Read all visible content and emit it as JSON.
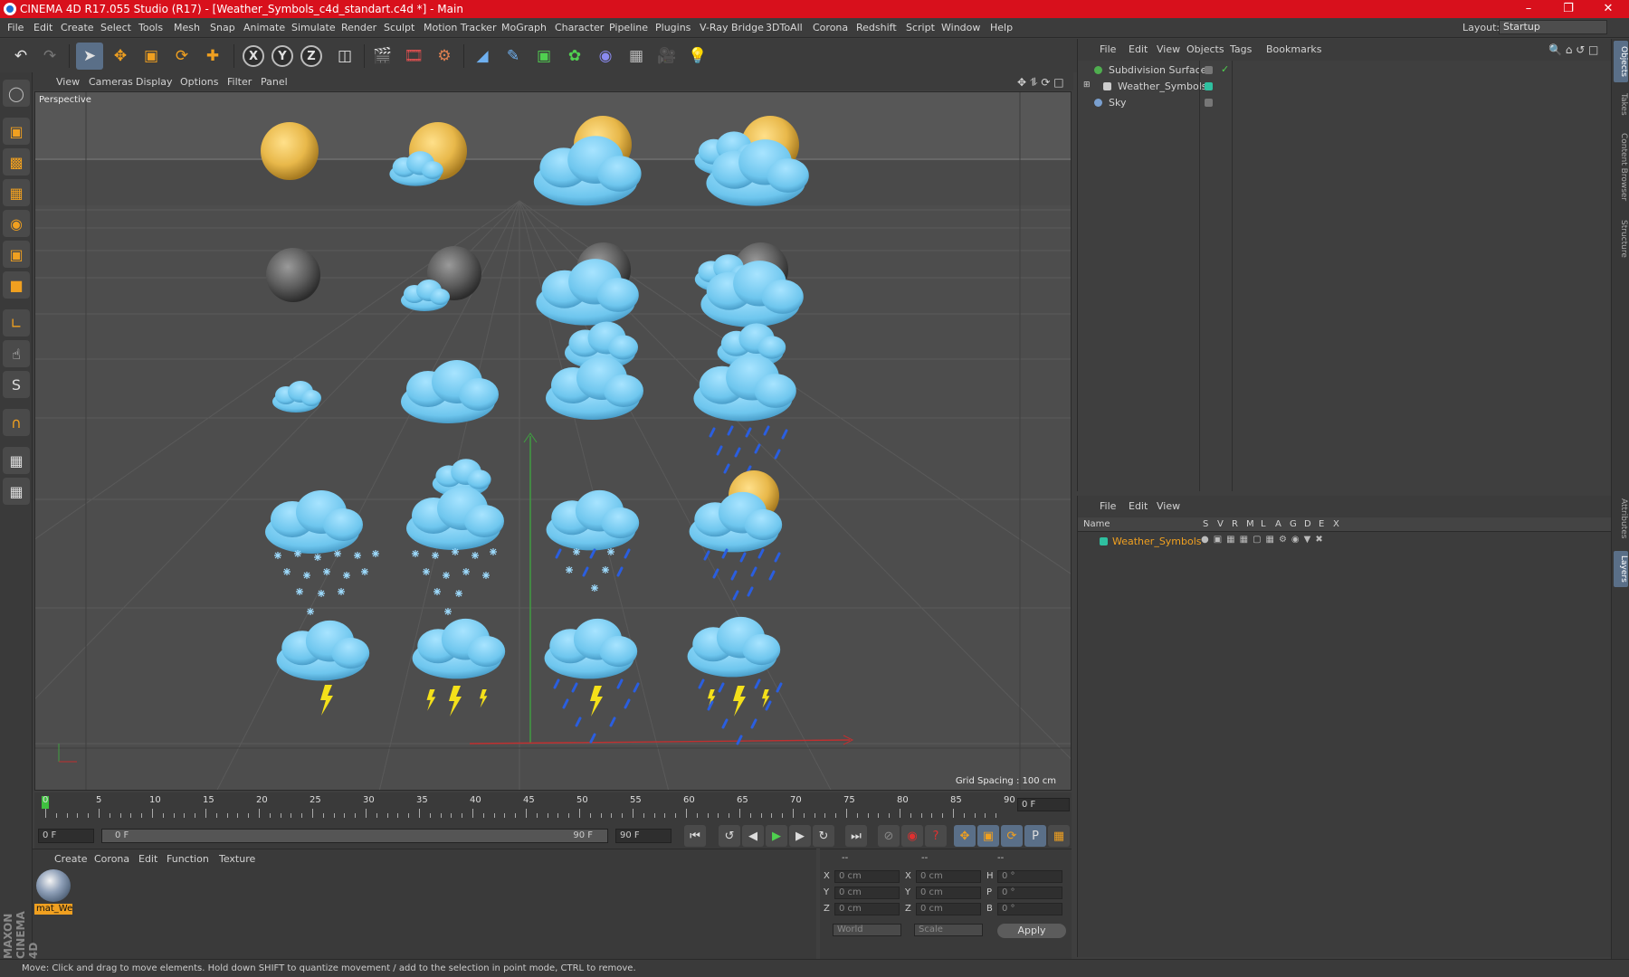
{
  "window": {
    "title": "CINEMA 4D R17.055 Studio (R17) - [Weather_Symbols_c4d_standart.c4d *] - Main"
  },
  "menu": [
    "File",
    "Edit",
    "Create",
    "Select",
    "Tools",
    "Mesh",
    "Snap",
    "Animate",
    "Simulate",
    "Render",
    "Sculpt",
    "Motion Tracker",
    "MoGraph",
    "Character",
    "Pipeline",
    "Plugins",
    "V-Ray Bridge",
    "3DToAll",
    "Corona",
    "Redshift",
    "Script",
    "Window",
    "Help"
  ],
  "layout": {
    "label": "Layout:",
    "value": "Startup"
  },
  "viewport": {
    "menu": [
      "View",
      "Cameras",
      "Display",
      "Options",
      "Filter",
      "Panel"
    ],
    "label": "Perspective",
    "grid_spacing": "Grid Spacing : 100 cm"
  },
  "timeline": {
    "ticks": [
      "0",
      "5",
      "10",
      "15",
      "20",
      "25",
      "30",
      "35",
      "40",
      "45",
      "50",
      "55",
      "60",
      "65",
      "70",
      "75",
      "80",
      "85",
      "90"
    ],
    "current_frame": "0 F",
    "start": "0 F",
    "range_start": "0 F",
    "range_end": "90 F",
    "end": "90 F"
  },
  "material_manager": {
    "menu": [
      "Create",
      "Corona",
      "Edit",
      "Function",
      "Texture"
    ],
    "materials": [
      {
        "name": "mat_We"
      }
    ]
  },
  "coordinates": {
    "headers": [
      "--",
      "--",
      "--"
    ],
    "rows": [
      {
        "a": "X",
        "av": "0 cm",
        "b": "X",
        "bv": "0 cm",
        "c": "H",
        "cv": "0 °"
      },
      {
        "a": "Y",
        "av": "0 cm",
        "b": "Y",
        "bv": "0 cm",
        "c": "P",
        "cv": "0 °"
      },
      {
        "a": "Z",
        "av": "0 cm",
        "b": "Z",
        "bv": "0 cm",
        "c": "B",
        "cv": "0 °"
      }
    ],
    "mode1": "World",
    "mode2": "Scale",
    "apply": "Apply"
  },
  "object_manager": {
    "menu": [
      "File",
      "Edit",
      "View",
      "Objects",
      "Tags",
      "Bookmarks"
    ],
    "objects": [
      {
        "name": "Subdivision Surface",
        "color": "#4fae4f"
      },
      {
        "name": "Weather_Symbols",
        "color": "#2fc0a0"
      },
      {
        "name": "Sky",
        "color": "#7aa0d0"
      }
    ]
  },
  "layer_manager": {
    "menu": [
      "File",
      "Edit",
      "View"
    ],
    "columns": [
      "Name",
      "S",
      "V",
      "R",
      "M",
      "L",
      "A",
      "G",
      "D",
      "E",
      "X"
    ],
    "layers": [
      {
        "name": "Weather_Symbols",
        "color": "#2fc0a0"
      }
    ]
  },
  "side_tabs": [
    "Objects",
    "Takes",
    "Content Browser",
    "Structure",
    "Attributes",
    "Layers"
  ],
  "status": "Move: Click and drag to move elements. Hold down SHIFT to quantize movement / add to the selection in point mode, CTRL to remove.",
  "brand": "MAXON CINEMA 4D"
}
